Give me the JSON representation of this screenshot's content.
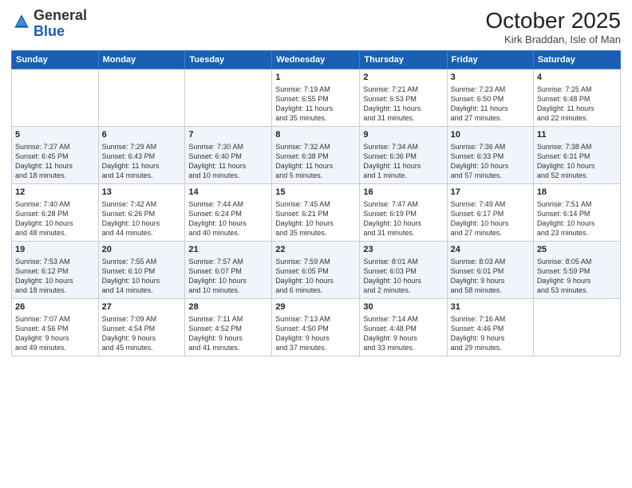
{
  "logo": {
    "line1": "General",
    "line2": "Blue"
  },
  "title": "October 2025",
  "subtitle": "Kirk Braddan, Isle of Man",
  "calendar": {
    "headers": [
      "Sunday",
      "Monday",
      "Tuesday",
      "Wednesday",
      "Thursday",
      "Friday",
      "Saturday"
    ],
    "rows": [
      [
        {
          "day": "",
          "info": ""
        },
        {
          "day": "",
          "info": ""
        },
        {
          "day": "",
          "info": ""
        },
        {
          "day": "1",
          "info": "Sunrise: 7:19 AM\nSunset: 6:55 PM\nDaylight: 11 hours\nand 35 minutes."
        },
        {
          "day": "2",
          "info": "Sunrise: 7:21 AM\nSunset: 6:53 PM\nDaylight: 11 hours\nand 31 minutes."
        },
        {
          "day": "3",
          "info": "Sunrise: 7:23 AM\nSunset: 6:50 PM\nDaylight: 11 hours\nand 27 minutes."
        },
        {
          "day": "4",
          "info": "Sunrise: 7:25 AM\nSunset: 6:48 PM\nDaylight: 11 hours\nand 22 minutes."
        }
      ],
      [
        {
          "day": "5",
          "info": "Sunrise: 7:27 AM\nSunset: 6:45 PM\nDaylight: 11 hours\nand 18 minutes."
        },
        {
          "day": "6",
          "info": "Sunrise: 7:29 AM\nSunset: 6:43 PM\nDaylight: 11 hours\nand 14 minutes."
        },
        {
          "day": "7",
          "info": "Sunrise: 7:30 AM\nSunset: 6:40 PM\nDaylight: 11 hours\nand 10 minutes."
        },
        {
          "day": "8",
          "info": "Sunrise: 7:32 AM\nSunset: 6:38 PM\nDaylight: 11 hours\nand 5 minutes."
        },
        {
          "day": "9",
          "info": "Sunrise: 7:34 AM\nSunset: 6:36 PM\nDaylight: 11 hours\nand 1 minute."
        },
        {
          "day": "10",
          "info": "Sunrise: 7:36 AM\nSunset: 6:33 PM\nDaylight: 10 hours\nand 57 minutes."
        },
        {
          "day": "11",
          "info": "Sunrise: 7:38 AM\nSunset: 6:31 PM\nDaylight: 10 hours\nand 52 minutes."
        }
      ],
      [
        {
          "day": "12",
          "info": "Sunrise: 7:40 AM\nSunset: 6:28 PM\nDaylight: 10 hours\nand 48 minutes."
        },
        {
          "day": "13",
          "info": "Sunrise: 7:42 AM\nSunset: 6:26 PM\nDaylight: 10 hours\nand 44 minutes."
        },
        {
          "day": "14",
          "info": "Sunrise: 7:44 AM\nSunset: 6:24 PM\nDaylight: 10 hours\nand 40 minutes."
        },
        {
          "day": "15",
          "info": "Sunrise: 7:45 AM\nSunset: 6:21 PM\nDaylight: 10 hours\nand 35 minutes."
        },
        {
          "day": "16",
          "info": "Sunrise: 7:47 AM\nSunset: 6:19 PM\nDaylight: 10 hours\nand 31 minutes."
        },
        {
          "day": "17",
          "info": "Sunrise: 7:49 AM\nSunset: 6:17 PM\nDaylight: 10 hours\nand 27 minutes."
        },
        {
          "day": "18",
          "info": "Sunrise: 7:51 AM\nSunset: 6:14 PM\nDaylight: 10 hours\nand 23 minutes."
        }
      ],
      [
        {
          "day": "19",
          "info": "Sunrise: 7:53 AM\nSunset: 6:12 PM\nDaylight: 10 hours\nand 18 minutes."
        },
        {
          "day": "20",
          "info": "Sunrise: 7:55 AM\nSunset: 6:10 PM\nDaylight: 10 hours\nand 14 minutes."
        },
        {
          "day": "21",
          "info": "Sunrise: 7:57 AM\nSunset: 6:07 PM\nDaylight: 10 hours\nand 10 minutes."
        },
        {
          "day": "22",
          "info": "Sunrise: 7:59 AM\nSunset: 6:05 PM\nDaylight: 10 hours\nand 6 minutes."
        },
        {
          "day": "23",
          "info": "Sunrise: 8:01 AM\nSunset: 6:03 PM\nDaylight: 10 hours\nand 2 minutes."
        },
        {
          "day": "24",
          "info": "Sunrise: 8:03 AM\nSunset: 6:01 PM\nDaylight: 9 hours\nand 58 minutes."
        },
        {
          "day": "25",
          "info": "Sunrise: 8:05 AM\nSunset: 5:59 PM\nDaylight: 9 hours\nand 53 minutes."
        }
      ],
      [
        {
          "day": "26",
          "info": "Sunrise: 7:07 AM\nSunset: 4:56 PM\nDaylight: 9 hours\nand 49 minutes."
        },
        {
          "day": "27",
          "info": "Sunrise: 7:09 AM\nSunset: 4:54 PM\nDaylight: 9 hours\nand 45 minutes."
        },
        {
          "day": "28",
          "info": "Sunrise: 7:11 AM\nSunset: 4:52 PM\nDaylight: 9 hours\nand 41 minutes."
        },
        {
          "day": "29",
          "info": "Sunrise: 7:13 AM\nSunset: 4:50 PM\nDaylight: 9 hours\nand 37 minutes."
        },
        {
          "day": "30",
          "info": "Sunrise: 7:14 AM\nSunset: 4:48 PM\nDaylight: 9 hours\nand 33 minutes."
        },
        {
          "day": "31",
          "info": "Sunrise: 7:16 AM\nSunset: 4:46 PM\nDaylight: 9 hours\nand 29 minutes."
        },
        {
          "day": "",
          "info": ""
        }
      ]
    ]
  }
}
